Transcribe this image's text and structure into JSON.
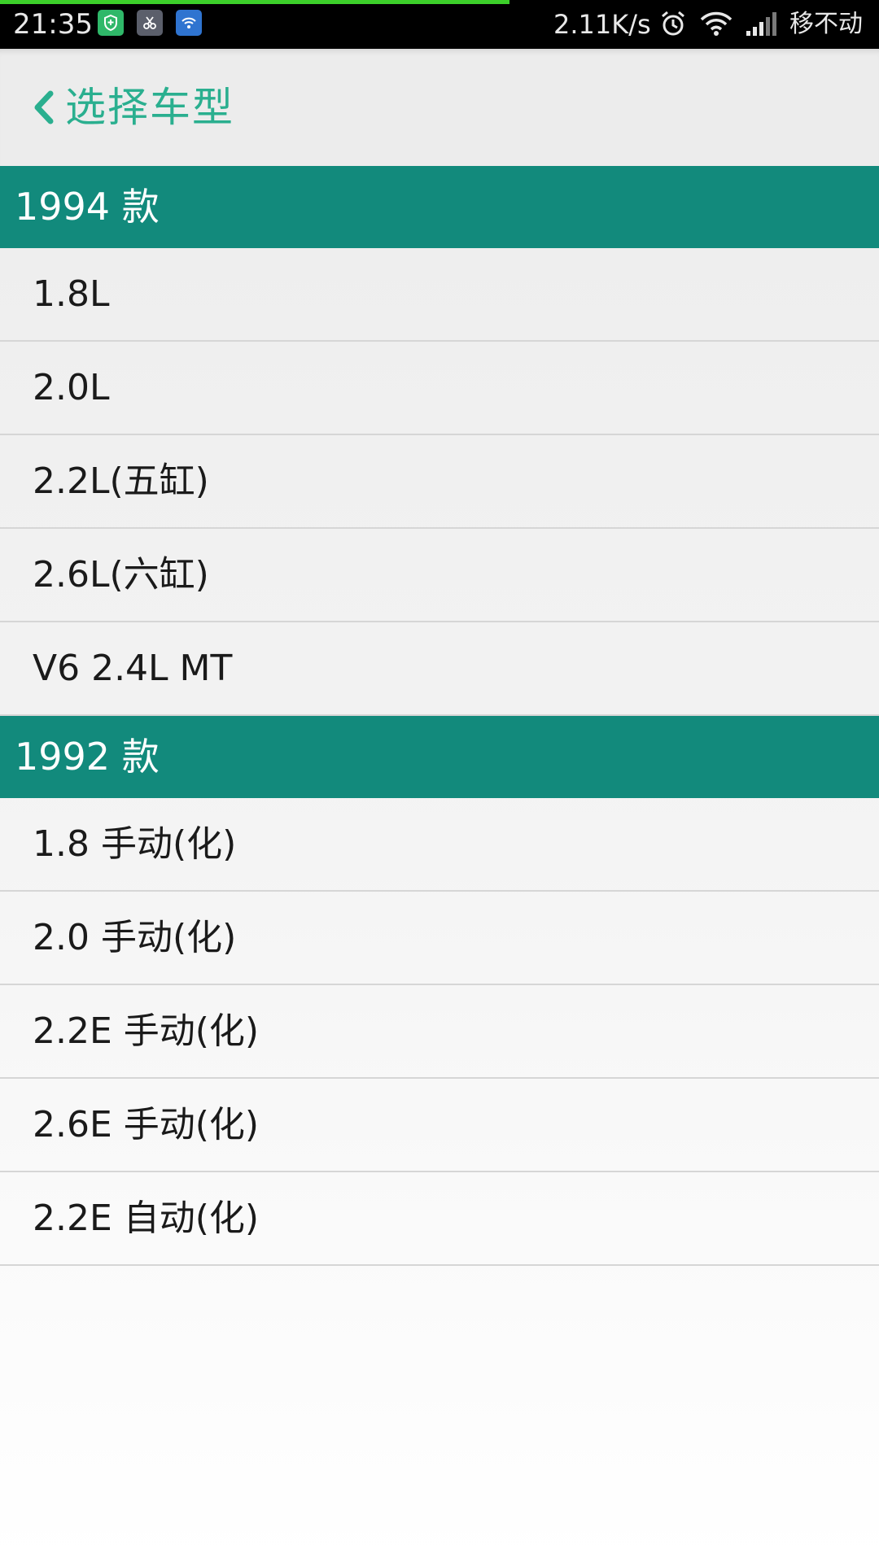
{
  "status_bar": {
    "time": "21:35",
    "speed": "2.11K/s",
    "carrier": "移不动",
    "page_load_progress": 0.58,
    "notification_icons": [
      "shield-icon",
      "scissors-icon",
      "wifi-app-icon"
    ],
    "system_icons": [
      "alarm-icon",
      "wifi-icon",
      "signal-icon"
    ]
  },
  "toolbar": {
    "back_icon": "chevron-left-icon",
    "title": "选择车型",
    "accent_color": "#2aaf8f"
  },
  "colors": {
    "section_header_bg": "#128a7c",
    "section_header_text": "#ffffff"
  },
  "sections": [
    {
      "title": "1994 款",
      "items": [
        "1.8L",
        "2.0L",
        "2.2L(五缸)",
        "2.6L(六缸)",
        "V6 2.4L MT"
      ]
    },
    {
      "title": "1992 款",
      "items": [
        "1.8 手动(化)",
        "2.0 手动(化)",
        "2.2E 手动(化)",
        "2.6E 手动(化)",
        "2.2E 自动(化)"
      ]
    }
  ]
}
